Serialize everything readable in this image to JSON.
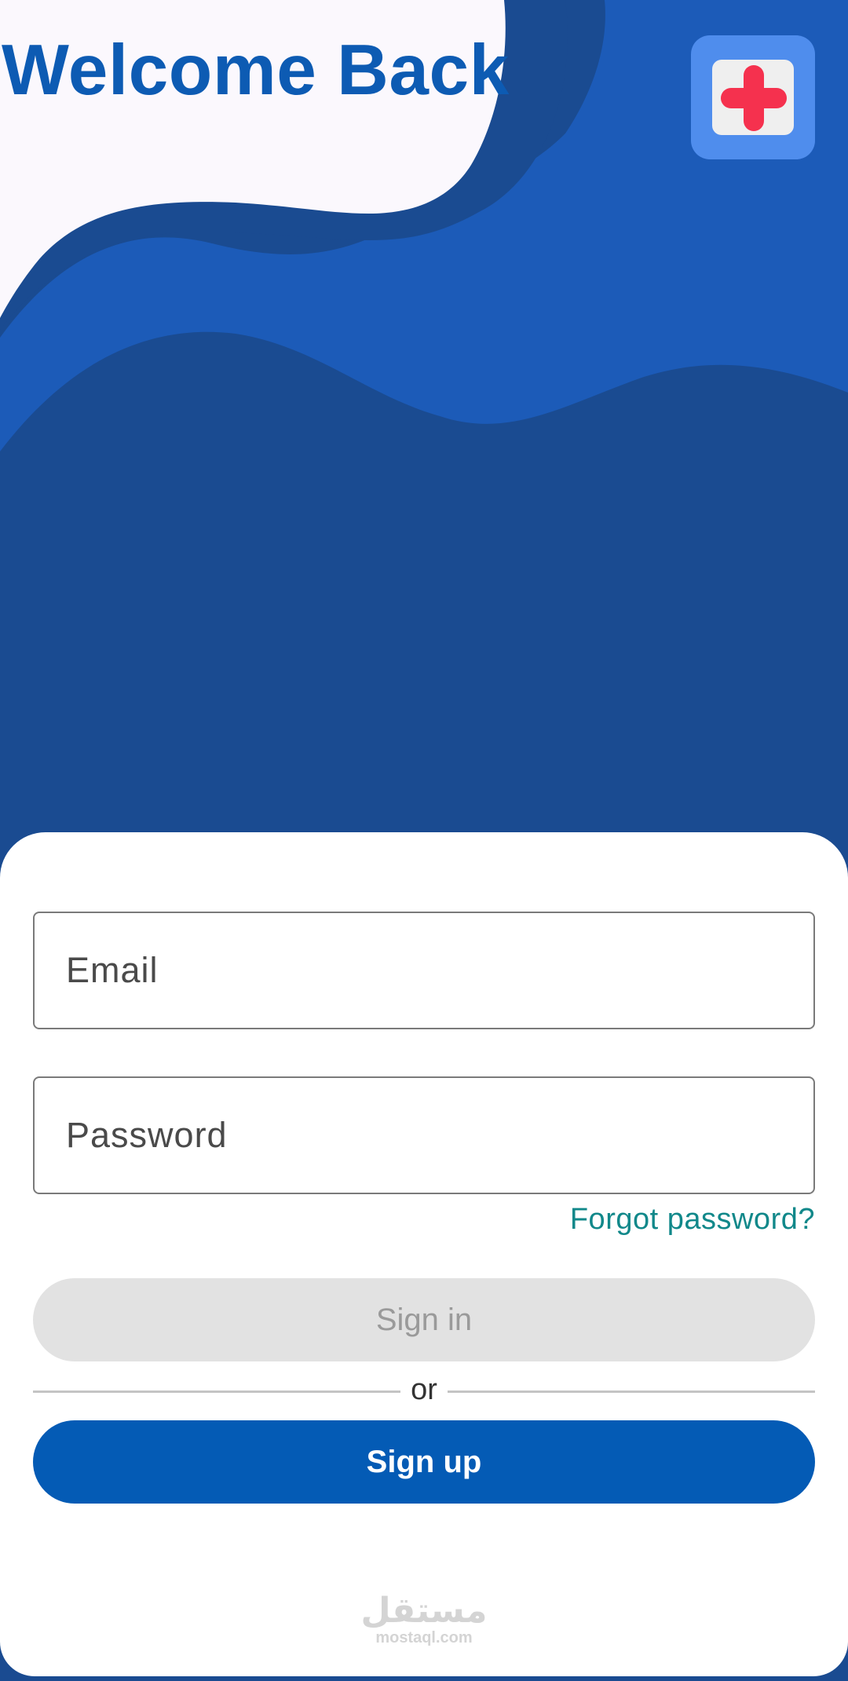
{
  "header": {
    "title": "Welcome Back",
    "logo_icon": "medical-cross-icon"
  },
  "login_form": {
    "email_placeholder": "Email",
    "password_placeholder": "Password",
    "forgot_password_label": "Forgot password?",
    "sign_in_label": "Sign in",
    "divider_label": "or",
    "sign_up_label": "Sign up"
  },
  "watermark": {
    "arabic": "مستقل",
    "latin": "mostaql.com"
  },
  "colors": {
    "title": "#0d5bb3",
    "wave_light": "#1c5bb8",
    "wave_dark": "#1a4b91",
    "logo_badge": "#4f8ded",
    "cross": "#f5314e",
    "forgot_link": "#11888a",
    "sign_in_disabled_bg": "#e2e2e2",
    "sign_up_bg": "#045bb5"
  }
}
